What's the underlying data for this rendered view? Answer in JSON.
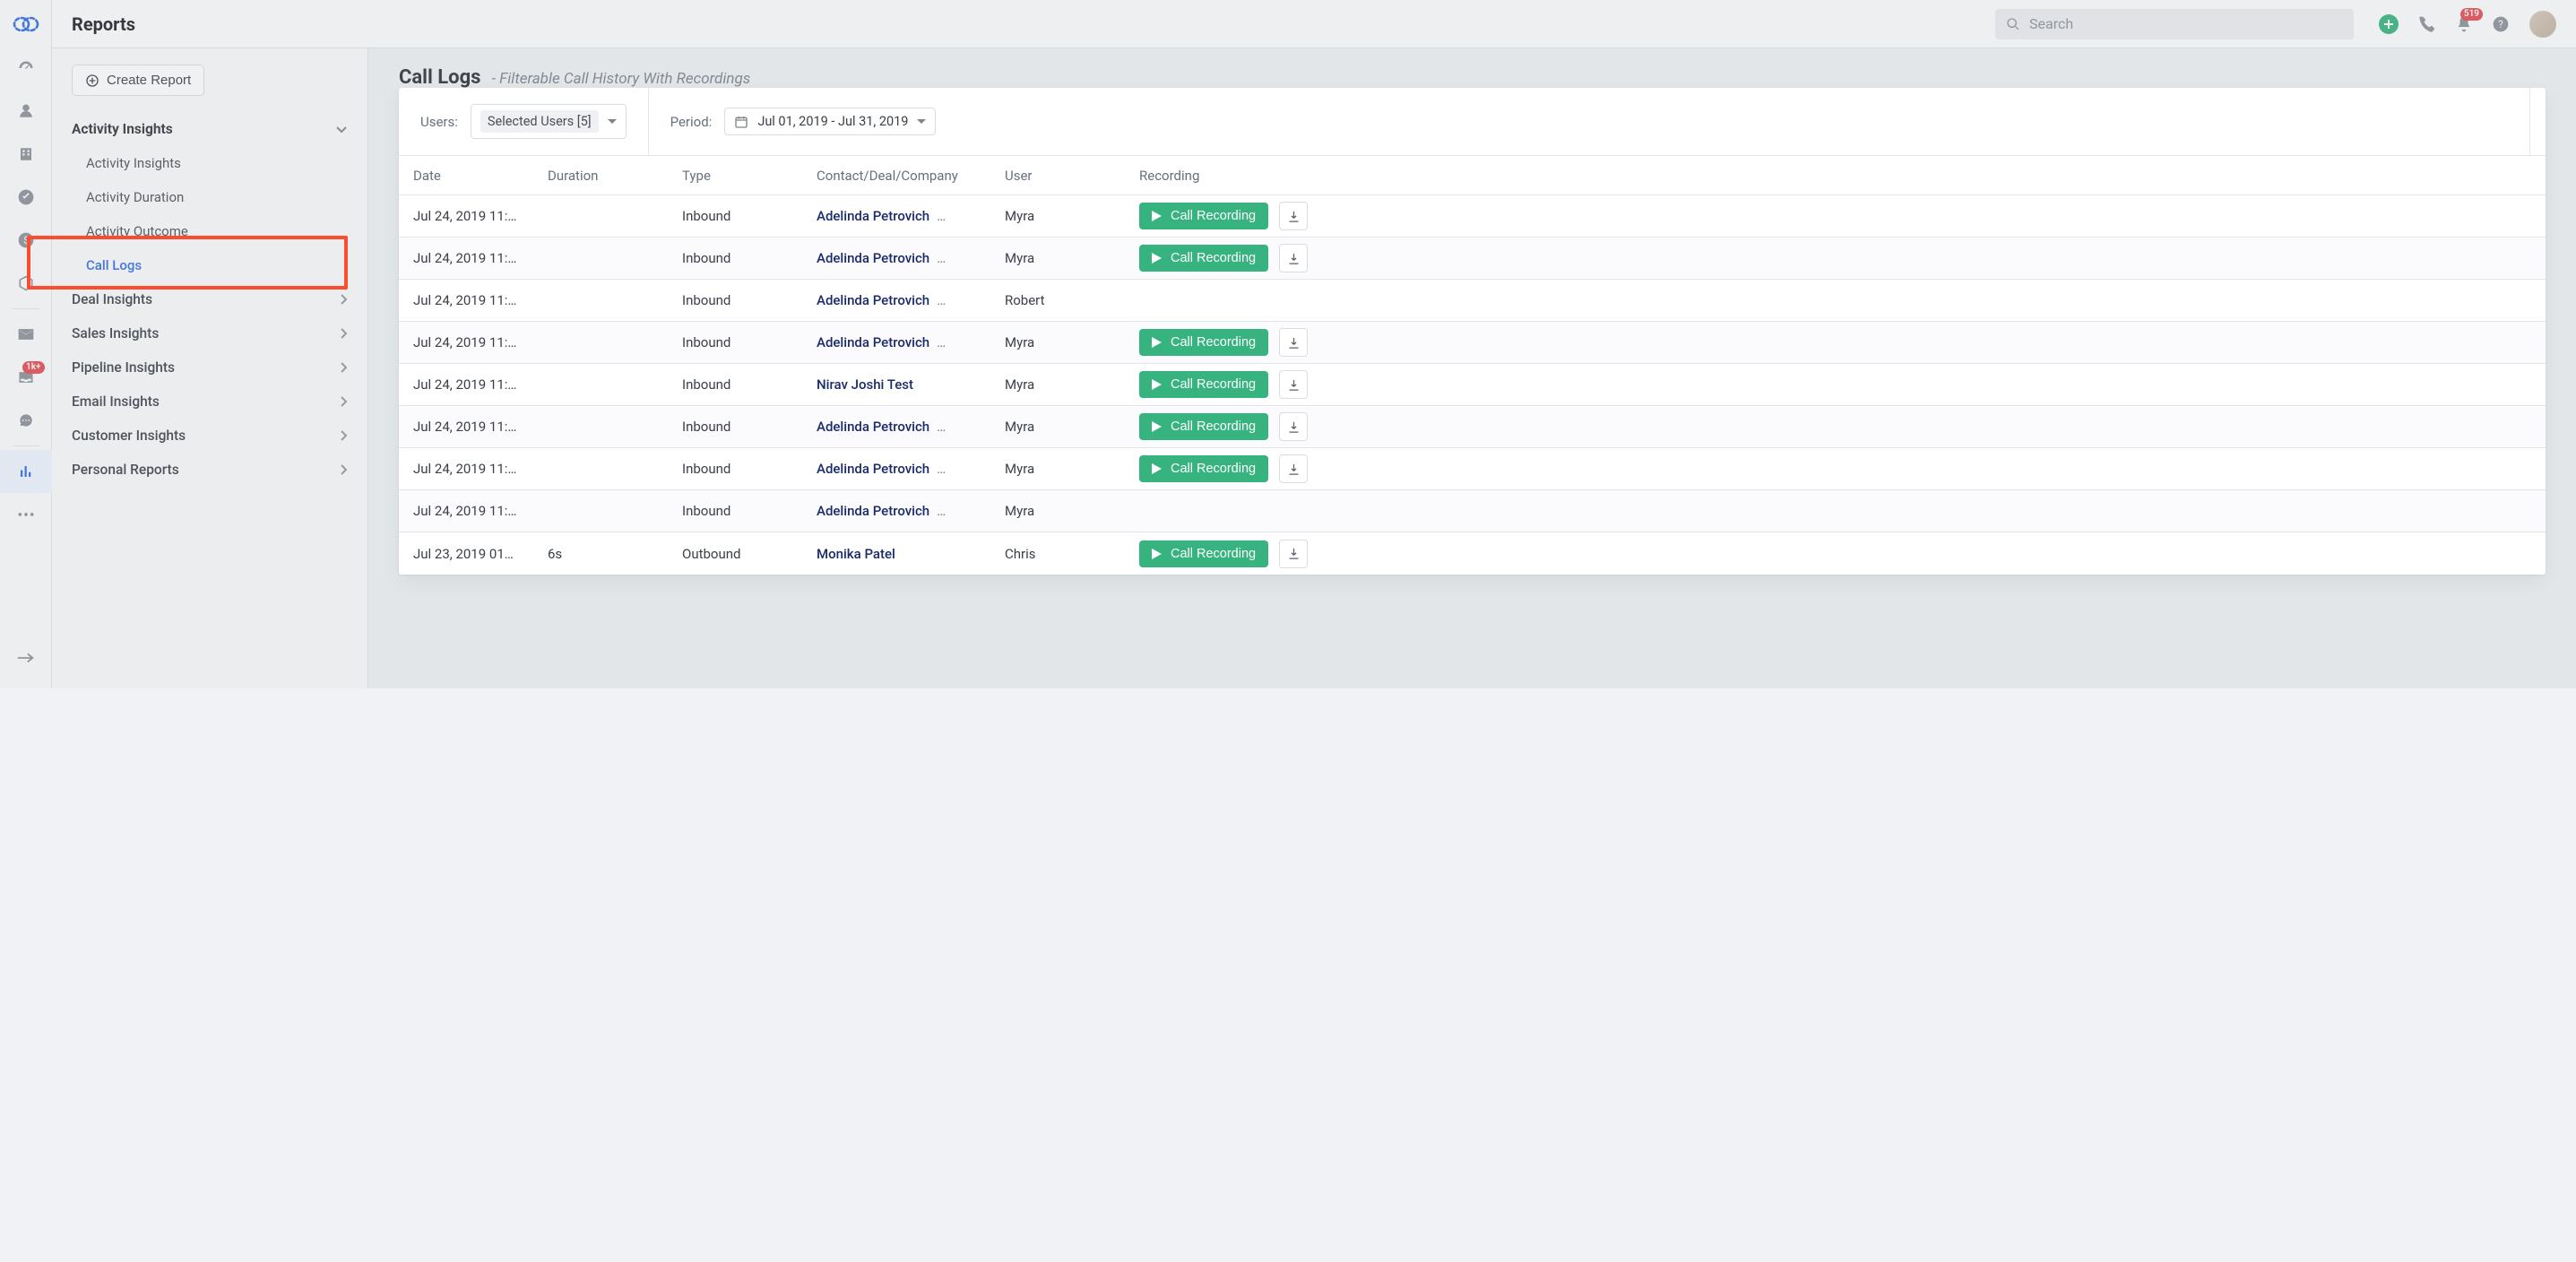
{
  "header": {
    "title": "Reports",
    "search_placeholder": "Search",
    "bell_badge": "519",
    "add_plus": "+"
  },
  "rail": {
    "mail_badge": "1k+"
  },
  "sidebar": {
    "create_label": "Create Report",
    "section_activity": "Activity Insights",
    "activity_items": [
      "Activity Insights",
      "Activity Duration",
      "Activity Outcome",
      "Call Logs"
    ],
    "active_index": 3,
    "groups": [
      "Deal Insights",
      "Sales Insights",
      "Pipeline Insights",
      "Email Insights",
      "Customer Insights",
      "Personal Reports"
    ]
  },
  "page": {
    "title": "Call Logs",
    "subtitle": "- Filterable Call History With Recordings"
  },
  "filters": {
    "users_label": "Users:",
    "users_value": "Selected Users [5]",
    "period_label": "Period:",
    "period_value": "Jul 01, 2019 - Jul 31, 2019"
  },
  "columns": [
    "Date",
    "Duration",
    "Type",
    "Contact/Deal/Company",
    "User",
    "Recording"
  ],
  "recording_button_label": "Call Recording",
  "rows": [
    {
      "date": "Jul 24, 2019 11:…",
      "duration": "",
      "type": "Inbound",
      "contact": "Adelinda Petrovich",
      "more": "…",
      "user": "Myra",
      "rec": true
    },
    {
      "date": "Jul 24, 2019 11:…",
      "duration": "",
      "type": "Inbound",
      "contact": "Adelinda Petrovich",
      "more": "…",
      "user": "Myra",
      "rec": true
    },
    {
      "date": "Jul 24, 2019 11:…",
      "duration": "",
      "type": "Inbound",
      "contact": "Adelinda Petrovich",
      "more": "…",
      "user": "Robert",
      "rec": false
    },
    {
      "date": "Jul 24, 2019 11:…",
      "duration": "",
      "type": "Inbound",
      "contact": "Adelinda Petrovich",
      "more": "…",
      "user": "Myra",
      "rec": true
    },
    {
      "date": "Jul 24, 2019 11:…",
      "duration": "",
      "type": "Inbound",
      "contact": "Nirav Joshi Test",
      "more": "",
      "user": "Myra",
      "rec": true
    },
    {
      "date": "Jul 24, 2019 11:…",
      "duration": "",
      "type": "Inbound",
      "contact": "Adelinda Petrovich",
      "more": "…",
      "user": "Myra",
      "rec": true
    },
    {
      "date": "Jul 24, 2019 11:…",
      "duration": "",
      "type": "Inbound",
      "contact": "Adelinda Petrovich",
      "more": "…",
      "user": "Myra",
      "rec": true
    },
    {
      "date": "Jul 24, 2019 11:…",
      "duration": "",
      "type": "Inbound",
      "contact": "Adelinda Petrovich",
      "more": "…",
      "user": "Myra",
      "rec": false
    },
    {
      "date": "Jul 23, 2019 01…",
      "duration": "6s",
      "type": "Outbound",
      "contact": "Monika Patel",
      "more": "",
      "user": "Chris",
      "rec": true
    }
  ]
}
